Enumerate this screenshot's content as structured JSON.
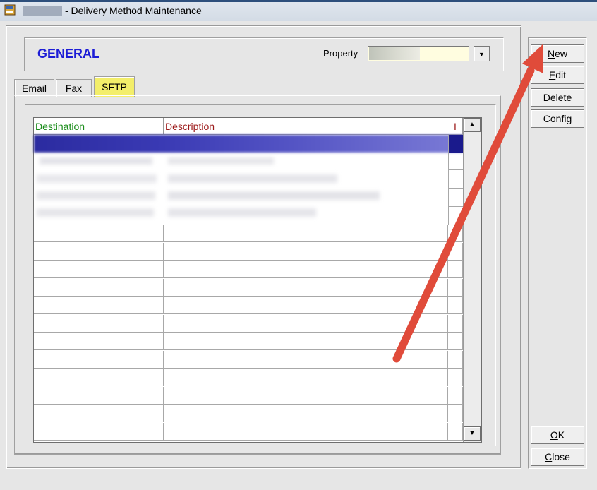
{
  "window": {
    "title": "- Delivery Method Maintenance"
  },
  "general": {
    "title": "GENERAL",
    "property_label": "Property",
    "property_dropdown_glyph": "▼"
  },
  "tabs": [
    {
      "label": "Email",
      "active": false
    },
    {
      "label": "Fax",
      "active": false
    },
    {
      "label": "SFTP",
      "active": true
    }
  ],
  "grid": {
    "columns": [
      "Destination",
      "Description",
      "I"
    ],
    "column_colors": [
      "#1a8c1a",
      "#9c1a1a",
      "#9c1a1a"
    ],
    "selection_color": "#1a1a8c",
    "rows_blurred": 5,
    "rows_empty": 12
  },
  "buttons": {
    "new": {
      "mnemonic": "N",
      "rest": "ew"
    },
    "edit": {
      "mnemonic": "E",
      "rest": "dit"
    },
    "delete": {
      "mnemonic": "D",
      "rest": "elete"
    },
    "config": {
      "label": "Config"
    },
    "ok": {
      "mnemonic": "O",
      "rest": "K"
    },
    "close": {
      "mnemonic": "C",
      "rest": "lose"
    }
  },
  "colors": {
    "annotation_arrow": "#e04b3a",
    "tab_active": "#f3ee6a",
    "general_title": "#1d1dd6"
  }
}
